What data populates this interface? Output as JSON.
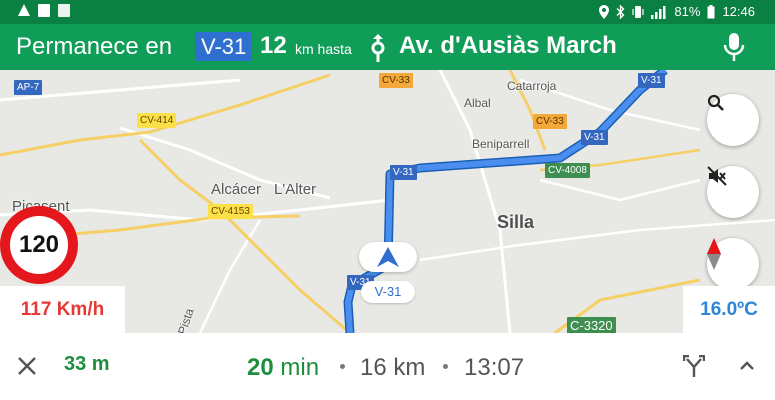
{
  "status_bar": {
    "battery": "81%",
    "time": "12:46"
  },
  "banner": {
    "prefix": "Permanece en",
    "route_shield": "V-31",
    "distance": "12",
    "distance_unit": "km hasta",
    "destination": "Av. d'Ausiàs March",
    "mic_icon": "mic-icon",
    "turn_icon": "roundabout-arrow-icon"
  },
  "map": {
    "places": [
      {
        "name": "Picasent"
      },
      {
        "name": "Alcácer"
      },
      {
        "name": "L'Alter"
      },
      {
        "name": "Catarroja"
      },
      {
        "name": "Albal"
      },
      {
        "name": "Beniparrell"
      },
      {
        "name": "Silla"
      },
      {
        "name": "Pista"
      }
    ],
    "road_labels": [
      "AP-7",
      "CV-414",
      "CV-33",
      "CV-33",
      "V-31",
      "V-31",
      "V-31",
      "CV-4008",
      "CV-4153",
      "V-31",
      "C-3320"
    ],
    "route_label": "V-31",
    "buttons": [
      "search-icon",
      "mute-icon",
      "compass-icon"
    ]
  },
  "speed": {
    "limit": "120",
    "current": "117 Km/h"
  },
  "weather": {
    "temperature": "16.0ºC"
  },
  "trip": {
    "next_distance": "33 m",
    "eta_minutes": "20",
    "eta_minutes_unit": "min",
    "remaining_distance": "16 km",
    "arrival_time": "13:07"
  },
  "colors": {
    "banner": "#0f9d58",
    "status_bar": "#0b8043",
    "route": "#4285f4",
    "speed_limit_ring": "#e4171c",
    "eta_green": "#1e8e3e"
  }
}
